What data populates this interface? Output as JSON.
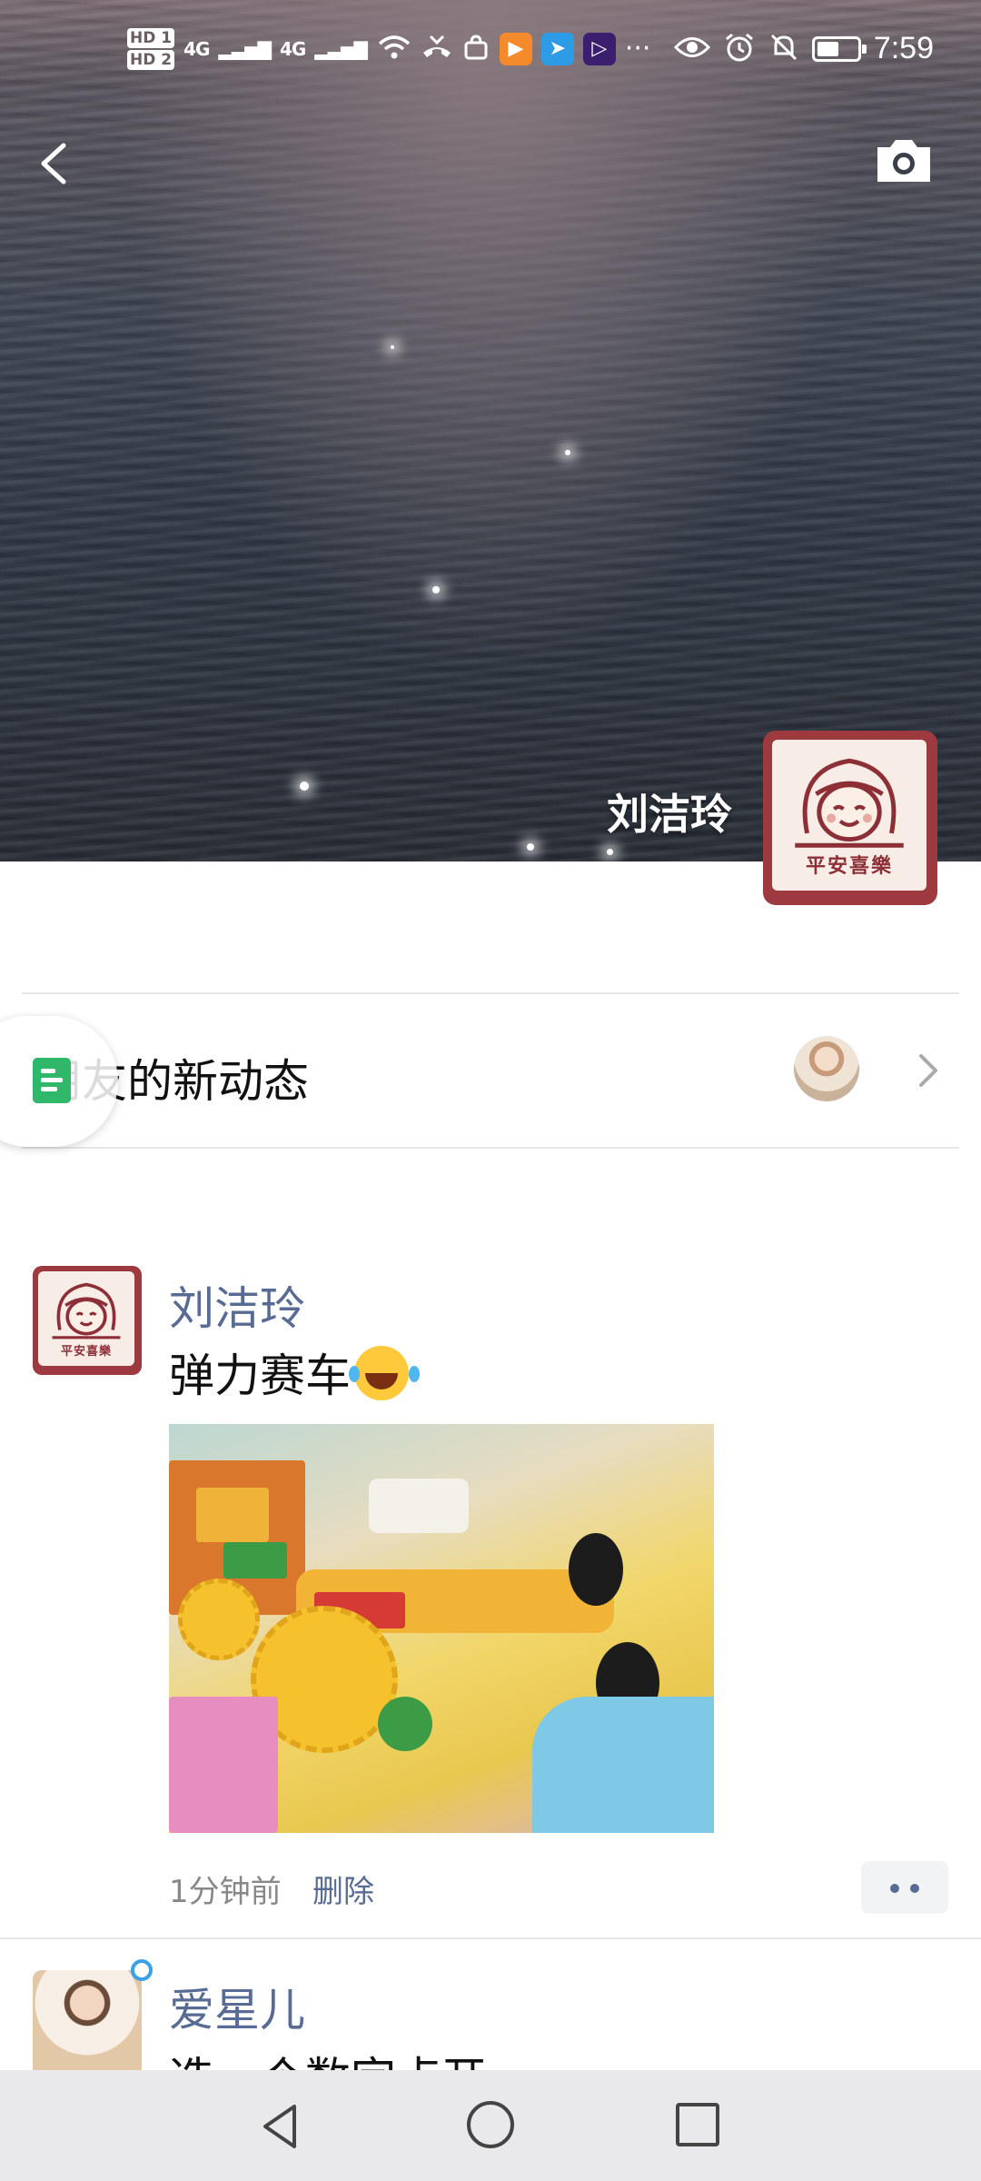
{
  "status_bar": {
    "hd1": "HD 1",
    "hd2": "HD 2",
    "signal1": "4G",
    "signal2": "4G",
    "more": "···",
    "time": "7:59",
    "battery_level": 0.55,
    "icons": [
      "wifi-icon",
      "missed-call-icon",
      "bag-icon",
      "video-app-icon",
      "telegram-icon",
      "media-app-icon",
      "eye-icon",
      "alarm-icon",
      "mute-icon",
      "battery-icon"
    ]
  },
  "cover": {
    "display_name": "刘洁玲",
    "avatar_caption": "平安喜樂",
    "back_icon": "chevron-left-icon",
    "camera_icon": "camera-icon"
  },
  "friends_activity": {
    "label": "朋友的新动态",
    "chevron_icon": "chevron-right-icon"
  },
  "posts": [
    {
      "author": "刘洁玲",
      "text": "弹力赛车",
      "emoji": "laughing-tears-emoji",
      "time": "1分钟前",
      "delete_label": "删除",
      "avatar_caption": "平安喜樂"
    },
    {
      "author": "爱星儿",
      "text": "选一个数字点开"
    }
  ],
  "colors": {
    "link_blue": "#576b95",
    "avatar_red": "#9c3a3f",
    "doc_green": "#2fb86a"
  }
}
